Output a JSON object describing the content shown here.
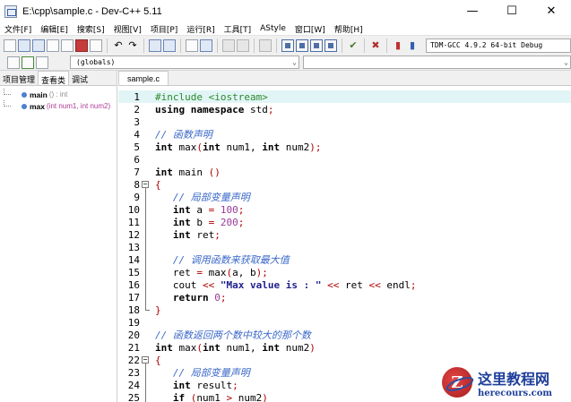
{
  "window": {
    "title": "E:\\cpp\\sample.c - Dev-C++ 5.11",
    "controls": {
      "minimize": "—",
      "maximize": "☐",
      "close": "✕"
    }
  },
  "menu": [
    "文件[F]",
    "编辑[E]",
    "搜索[S]",
    "视图[V]",
    "项目[P]",
    "运行[R]",
    "工具[T]",
    "AStyle",
    "窗口[W]",
    "帮助[H]"
  ],
  "toolbar": {
    "compiler": "TDM-GCC 4.9.2 64-bit Debug"
  },
  "toolbar2": {
    "scope": "(globals)",
    "symbol": ""
  },
  "left_panel": {
    "tabs": [
      "项目管理",
      "查看类",
      "调试"
    ],
    "active_tab": 1,
    "tree": [
      {
        "name": "main",
        "signature": "() : int"
      },
      {
        "name": "max",
        "signature": "(int num1, int num2)"
      }
    ]
  },
  "editor": {
    "file_tab": "sample.c",
    "highlighted_line": 1,
    "lines": [
      {
        "n": "1",
        "fold": "",
        "tokens": [
          {
            "t": "#include <iostream>",
            "c": "pp"
          }
        ]
      },
      {
        "n": "2",
        "fold": "",
        "tokens": [
          {
            "t": "using namespace",
            "c": "kw"
          },
          {
            "t": " std",
            "c": "tx"
          },
          {
            "t": ";",
            "c": "sy"
          }
        ]
      },
      {
        "n": "3",
        "fold": "",
        "tokens": []
      },
      {
        "n": "4",
        "fold": "",
        "tokens": [
          {
            "t": "// 函数声明",
            "c": "cm"
          }
        ]
      },
      {
        "n": "5",
        "fold": "",
        "tokens": [
          {
            "t": "int",
            "c": "kw"
          },
          {
            "t": " max",
            "c": "tx"
          },
          {
            "t": "(",
            "c": "sy"
          },
          {
            "t": "int",
            "c": "kw"
          },
          {
            "t": " num1, ",
            "c": "tx"
          },
          {
            "t": "int",
            "c": "kw"
          },
          {
            "t": " num2",
            "c": "tx"
          },
          {
            "t": ");",
            "c": "sy"
          }
        ]
      },
      {
        "n": "6",
        "fold": "",
        "tokens": []
      },
      {
        "n": "7",
        "fold": "",
        "tokens": [
          {
            "t": "int",
            "c": "kw"
          },
          {
            "t": " main ",
            "c": "tx"
          },
          {
            "t": "()",
            "c": "sy"
          }
        ]
      },
      {
        "n": "8",
        "fold": "open",
        "tokens": [
          {
            "t": "{",
            "c": "sy"
          }
        ]
      },
      {
        "n": "9",
        "fold": "line",
        "tokens": [
          {
            "t": "   // 局部变量声明",
            "c": "cm"
          }
        ]
      },
      {
        "n": "10",
        "fold": "line",
        "tokens": [
          {
            "t": "   ",
            "c": "tx"
          },
          {
            "t": "int",
            "c": "kw"
          },
          {
            "t": " a ",
            "c": "tx"
          },
          {
            "t": "=",
            "c": "sy"
          },
          {
            "t": " ",
            "c": "tx"
          },
          {
            "t": "100",
            "c": "nu"
          },
          {
            "t": ";",
            "c": "sy"
          }
        ]
      },
      {
        "n": "11",
        "fold": "line",
        "tokens": [
          {
            "t": "   ",
            "c": "tx"
          },
          {
            "t": "int",
            "c": "kw"
          },
          {
            "t": " b ",
            "c": "tx"
          },
          {
            "t": "=",
            "c": "sy"
          },
          {
            "t": " ",
            "c": "tx"
          },
          {
            "t": "200",
            "c": "nu"
          },
          {
            "t": ";",
            "c": "sy"
          }
        ]
      },
      {
        "n": "12",
        "fold": "line",
        "tokens": [
          {
            "t": "   ",
            "c": "tx"
          },
          {
            "t": "int",
            "c": "kw"
          },
          {
            "t": " ret",
            "c": "tx"
          },
          {
            "t": ";",
            "c": "sy"
          }
        ]
      },
      {
        "n": "13",
        "fold": "line",
        "tokens": []
      },
      {
        "n": "14",
        "fold": "line",
        "tokens": [
          {
            "t": "   // 调用函数来获取最大值",
            "c": "cm"
          }
        ]
      },
      {
        "n": "15",
        "fold": "line",
        "tokens": [
          {
            "t": "   ret ",
            "c": "tx"
          },
          {
            "t": "=",
            "c": "sy"
          },
          {
            "t": " max",
            "c": "tx"
          },
          {
            "t": "(",
            "c": "sy"
          },
          {
            "t": "a, b",
            "c": "tx"
          },
          {
            "t": ");",
            "c": "sy"
          }
        ]
      },
      {
        "n": "16",
        "fold": "line",
        "tokens": [
          {
            "t": "   cout ",
            "c": "tx"
          },
          {
            "t": "<<",
            "c": "sy"
          },
          {
            "t": " ",
            "c": "tx"
          },
          {
            "t": "\"Max value is : \"",
            "c": "st"
          },
          {
            "t": " ",
            "c": "tx"
          },
          {
            "t": "<<",
            "c": "sy"
          },
          {
            "t": " ret ",
            "c": "tx"
          },
          {
            "t": "<<",
            "c": "sy"
          },
          {
            "t": " endl",
            "c": "tx"
          },
          {
            "t": ";",
            "c": "sy"
          }
        ]
      },
      {
        "n": "17",
        "fold": "line",
        "tokens": [
          {
            "t": "   ",
            "c": "tx"
          },
          {
            "t": "return",
            "c": "kw"
          },
          {
            "t": " ",
            "c": "tx"
          },
          {
            "t": "0",
            "c": "nu"
          },
          {
            "t": ";",
            "c": "sy"
          }
        ]
      },
      {
        "n": "18",
        "fold": "end",
        "tokens": [
          {
            "t": "}",
            "c": "sy"
          }
        ]
      },
      {
        "n": "19",
        "fold": "",
        "tokens": []
      },
      {
        "n": "20",
        "fold": "",
        "tokens": [
          {
            "t": "// 函数返回两个数中较大的那个数",
            "c": "cm"
          }
        ]
      },
      {
        "n": "21",
        "fold": "",
        "tokens": [
          {
            "t": "int",
            "c": "kw"
          },
          {
            "t": " max",
            "c": "tx"
          },
          {
            "t": "(",
            "c": "sy"
          },
          {
            "t": "int",
            "c": "kw"
          },
          {
            "t": " num1, ",
            "c": "tx"
          },
          {
            "t": "int",
            "c": "kw"
          },
          {
            "t": " num2",
            "c": "tx"
          },
          {
            "t": ")",
            "c": "sy"
          }
        ]
      },
      {
        "n": "22",
        "fold": "open",
        "tokens": [
          {
            "t": "{",
            "c": "sy"
          }
        ]
      },
      {
        "n": "23",
        "fold": "line",
        "tokens": [
          {
            "t": "   // 局部变量声明",
            "c": "cm"
          }
        ]
      },
      {
        "n": "24",
        "fold": "line",
        "tokens": [
          {
            "t": "   ",
            "c": "tx"
          },
          {
            "t": "int",
            "c": "kw"
          },
          {
            "t": " result",
            "c": "tx"
          },
          {
            "t": ";",
            "c": "sy"
          }
        ]
      },
      {
        "n": "25",
        "fold": "line",
        "tokens": [
          {
            "t": "   ",
            "c": "tx"
          },
          {
            "t": "if",
            "c": "kw"
          },
          {
            "t": " ",
            "c": "tx"
          },
          {
            "t": "(",
            "c": "sy"
          },
          {
            "t": "num1 ",
            "c": "tx"
          },
          {
            "t": ">",
            "c": "sy"
          },
          {
            "t": " num2",
            "c": "tx"
          },
          {
            "t": ")",
            "c": "sy"
          }
        ]
      }
    ]
  },
  "watermark": {
    "cn": "这里教程网",
    "en": "herecours.com"
  },
  "colors": {
    "line_highlight": "#e2f5f6",
    "preprocessor": "#2c8a2c",
    "comment": "#3a68c8",
    "number": "#9a3a9a",
    "string": "#1f1f8f",
    "symbol": "#b00000"
  }
}
